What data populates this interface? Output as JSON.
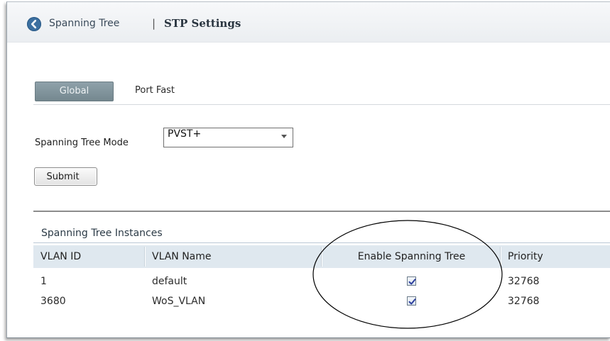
{
  "breadcrumb": {
    "parent": "Spanning Tree",
    "separator": "|",
    "current": "STP Settings"
  },
  "tabs": [
    {
      "label": "Global",
      "active": true
    },
    {
      "label": "Port Fast",
      "active": false
    }
  ],
  "mode": {
    "label": "Spanning Tree Mode",
    "value": "PVST+"
  },
  "submit_label": "Submit",
  "instances": {
    "title": "Spanning Tree Instances",
    "columns": [
      "VLAN ID",
      "VLAN Name",
      "Enable Spanning Tree",
      "Priority"
    ],
    "rows": [
      {
        "vlan_id": "1",
        "vlan_name": "default",
        "enabled": true,
        "priority": "32768"
      },
      {
        "vlan_id": "3680",
        "vlan_name": "WoS_VLAN",
        "enabled": true,
        "priority": "32768"
      }
    ]
  },
  "colors": {
    "accent": "#3b6fa0",
    "active_tab": "#7f929a",
    "table_header": "#dfe8ef"
  },
  "icons": {
    "back": "chevron-left-icon",
    "dropdown": "chevron-down-icon",
    "checkbox": "checkmark-icon"
  }
}
